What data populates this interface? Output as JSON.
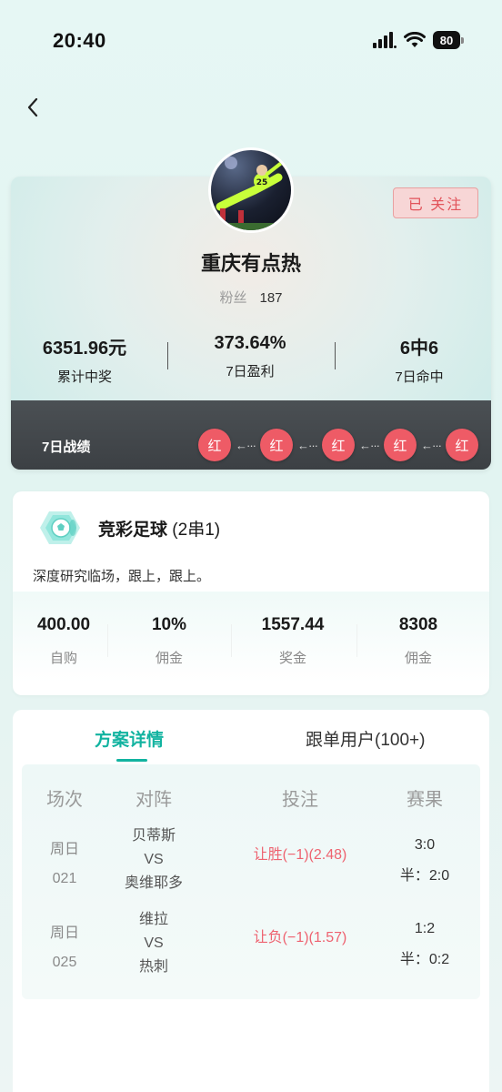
{
  "status_bar": {
    "time": "20:40",
    "battery": "80"
  },
  "profile": {
    "follow_label": "已 关注",
    "name": "重庆有点热",
    "fans_label": "粉丝",
    "fans_count": "187",
    "avatar_jersey": "25",
    "stats": [
      {
        "value": "6351.96元",
        "label": "累计中奖"
      },
      {
        "value": "373.64%",
        "label": "7日盈利"
      },
      {
        "value": "6中6",
        "label": "7日命中"
      }
    ],
    "record": {
      "label": "7日战绩",
      "items": [
        "红",
        "红",
        "红",
        "红",
        "红"
      ],
      "arrow": "←···"
    }
  },
  "plan": {
    "title": "竞彩足球",
    "title_suffix": "(2串1)",
    "description": "深度研究临场，跟上，跟上。",
    "stats": [
      {
        "value": "400.00",
        "label": "自购"
      },
      {
        "value": "10%",
        "label": "佣金"
      },
      {
        "value": "1557.44",
        "label": "奖金"
      },
      {
        "value": "8308",
        "label": "佣金"
      }
    ]
  },
  "detail": {
    "tabs": [
      "方案详情",
      "跟单用户(100+)"
    ],
    "headers": [
      "场次",
      "对阵",
      "投注",
      "赛果"
    ],
    "rows": [
      {
        "day": "周日",
        "num": "021",
        "home": "贝蒂斯",
        "vs": "VS",
        "away": "奥维耶多",
        "bet": "让胜(−1)(2.48)",
        "score": "3:0",
        "half": "半：2:0"
      },
      {
        "day": "周日",
        "num": "025",
        "home": "维拉",
        "vs": "VS",
        "away": "热刺",
        "bet": "让负(−1)(1.57)",
        "score": "1:2",
        "half": "半：0:2"
      }
    ]
  },
  "colors": {
    "accent": "#12b3a0",
    "red": "#ee5b66",
    "follow_bg": "#f7d6d6"
  }
}
